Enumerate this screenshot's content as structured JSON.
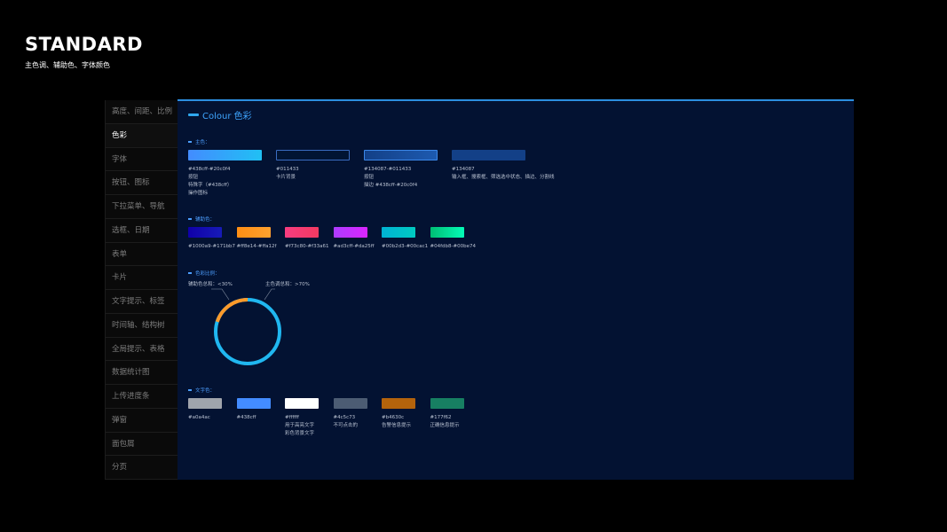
{
  "header": {
    "title": "STANDARD",
    "subtitle": "主色调、辅助色、字体颜色"
  },
  "sidebar": {
    "items": [
      {
        "label": "高度、间距、比例",
        "active": false
      },
      {
        "label": "色彩",
        "active": true
      },
      {
        "label": "字体",
        "active": false
      },
      {
        "label": "按钮、图标",
        "active": false
      },
      {
        "label": "下拉菜单、导航",
        "active": false
      },
      {
        "label": "选框、日期",
        "active": false
      },
      {
        "label": "表单",
        "active": false
      },
      {
        "label": "卡片",
        "active": false
      },
      {
        "label": "文字提示、标签",
        "active": false
      },
      {
        "label": "时间轴、结构树",
        "active": false
      },
      {
        "label": "全局提示、表格",
        "active": false
      },
      {
        "label": "数据统计图",
        "active": false
      },
      {
        "label": "上传进度条",
        "active": false
      },
      {
        "label": "弹窗",
        "active": false
      },
      {
        "label": "面包屑",
        "active": false
      },
      {
        "label": "分页",
        "active": false
      }
    ]
  },
  "main": {
    "section_title": "Colour 色彩",
    "primary": {
      "label": "主色：",
      "swatches": [
        {
          "code": "#438cff-#20c0f4",
          "lines": [
            "按钮",
            "特殊字（#438cff）",
            "操作图标"
          ],
          "from": "#438cff",
          "to": "#20c0f4"
        },
        {
          "code": "#011433",
          "lines": [
            "卡片背景"
          ],
          "from": "#011433",
          "to": "#011433"
        },
        {
          "code": "#134087-#011433",
          "lines": [
            "按钮",
            "描边 #438cff-#20c0f4"
          ],
          "from": "#134087",
          "to": "#1d5ab0"
        },
        {
          "code": "#134087",
          "lines": [
            "输入框、搜索框、筛选选中状态、描边、分割线"
          ],
          "from": "#134087",
          "to": "#134087"
        }
      ]
    },
    "secondary": {
      "label": "辅助色：",
      "swatches": [
        {
          "code": "#1000a9-#171bb7",
          "from": "#1000a9",
          "to": "#171bb7"
        },
        {
          "code": "#ff8e14-#ffa12f",
          "from": "#ff8e14",
          "to": "#ffa12f"
        },
        {
          "code": "#f73c80-#f33a61",
          "from": "#f73c80",
          "to": "#f33a61"
        },
        {
          "code": "#ad3cff-#da25ff",
          "from": "#ad3cff",
          "to": "#da25ff"
        },
        {
          "code": "#00b2d3-#00cac1",
          "from": "#00b2d3",
          "to": "#00cac1"
        },
        {
          "code": "#04fdb8-#00be74",
          "from": "#00be74",
          "to": "#04fdb8"
        }
      ]
    },
    "ratio": {
      "label": "色彩比例：",
      "secondary_note": "辅助色总和：<30%",
      "primary_note": "主色调总和：>70%",
      "secondary_share": 0.2,
      "primary_color": "#20b7f0",
      "secondary_color": "#ff9a2a"
    },
    "text_colors": {
      "label": "文字色：",
      "swatches": [
        {
          "code": "#a0a4ac",
          "lines": [],
          "color": "#a0a4ac"
        },
        {
          "code": "#438cff",
          "lines": [],
          "color": "#438cff"
        },
        {
          "code": "#ffffff",
          "lines": [
            "用于高亮文字",
            "彩色背景文字"
          ],
          "color": "#ffffff"
        },
        {
          "code": "#4c5c73",
          "lines": [
            "不可点击的"
          ],
          "color": "#4c5c73"
        },
        {
          "code": "#b4630c",
          "lines": [
            "告警信息提示"
          ],
          "color": "#b4630c"
        },
        {
          "code": "#177f62",
          "lines": [
            "正确信息提示"
          ],
          "color": "#177f62"
        }
      ]
    }
  }
}
